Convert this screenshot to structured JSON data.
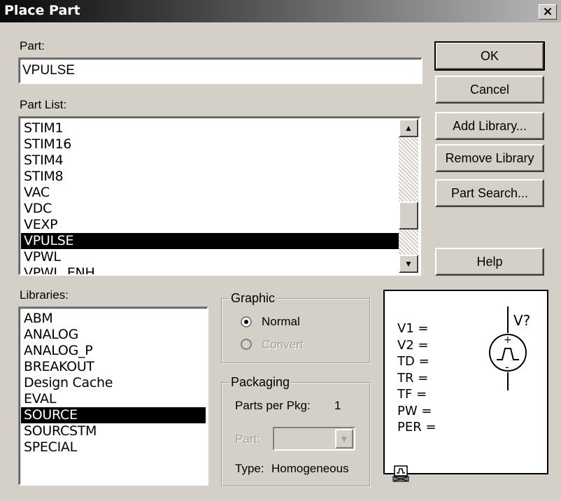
{
  "dialog": {
    "title": "Place Part",
    "close_label": "×"
  },
  "part": {
    "label": "Part:",
    "value": "VPULSE"
  },
  "part_list": {
    "label": "Part List:",
    "items": [
      "STIM1",
      "STIM16",
      "STIM4",
      "STIM8",
      "VAC",
      "VDC",
      "VEXP",
      "VPULSE",
      "VPWL",
      "VPWL_ENH"
    ],
    "selected": "VPULSE"
  },
  "libraries": {
    "label": "Libraries:",
    "items": [
      "ABM",
      "ANALOG",
      "ANALOG_P",
      "BREAKOUT",
      "Design Cache",
      "EVAL",
      "SOURCE",
      "SOURCSTM",
      "SPECIAL"
    ],
    "selected": "SOURCE"
  },
  "buttons": {
    "ok": "OK",
    "cancel": "Cancel",
    "add_library": "Add Library...",
    "remove_library": "Remove Library",
    "part_search": "Part Search...",
    "help": "Help"
  },
  "graphic": {
    "legend": "Graphic",
    "normal": "Normal",
    "convert": "Convert",
    "selected": "Normal"
  },
  "packaging": {
    "legend": "Packaging",
    "parts_per_pkg_label": "Parts per Pkg:",
    "parts_per_pkg_value": "1",
    "part_label": "Part:",
    "part_value": "",
    "type_label": "Type:",
    "type_value": "Homogeneous"
  },
  "preview": {
    "reference": "V?",
    "params": [
      "V1 =",
      "V2 =",
      "TD =",
      "TR =",
      "TF =",
      "PW =",
      "PER ="
    ]
  },
  "icons": {
    "close": "close-icon",
    "scroll_up": "scroll-up-arrow-icon",
    "scroll_down": "scroll-down-arrow-icon",
    "combo_arrow": "chevron-down-icon",
    "pulse_source": "pulse-voltage-source-icon",
    "preview_toggle": "small-schematic-icon"
  }
}
